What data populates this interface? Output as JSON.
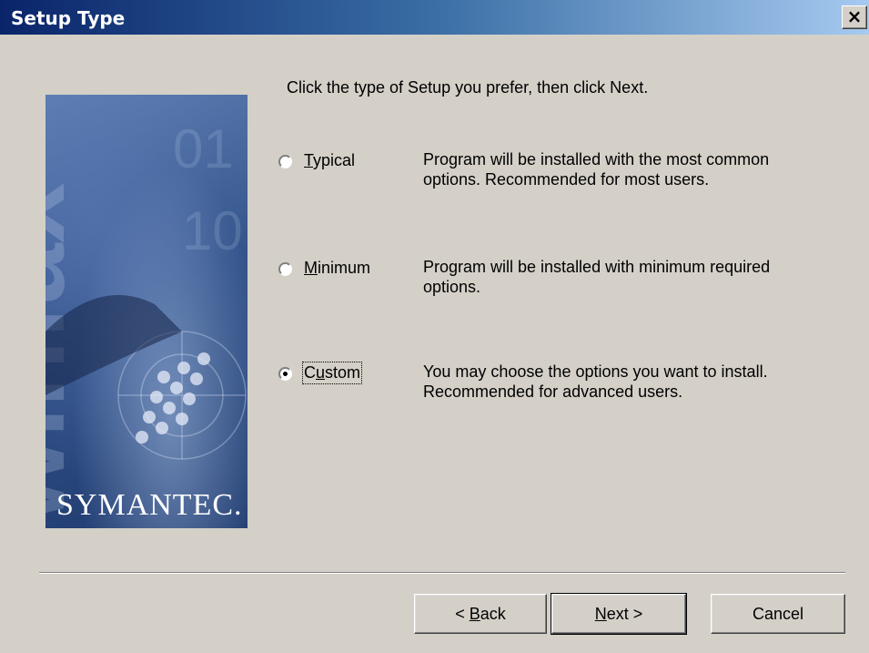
{
  "window": {
    "title": "Setup Type",
    "close_label": "×"
  },
  "banner": {
    "brand": "SYMANTEC."
  },
  "instruction": "Click the type of Setup you prefer, then click Next.",
  "options": [
    {
      "label": "Typical",
      "accel": "T",
      "description": "Program will be installed with the most common\noptions.  Recommended for most users.",
      "selected": false
    },
    {
      "label": "Minimum",
      "accel": "M",
      "description": "Program will be installed with minimum required\noptions.",
      "selected": false
    },
    {
      "label": "Custom",
      "accel": "u",
      "description": "You may choose the options you want to install.\nRecommended for advanced users.",
      "selected": true
    }
  ],
  "buttons": {
    "back": "< Back",
    "next": "Next >",
    "cancel": "Cancel"
  }
}
